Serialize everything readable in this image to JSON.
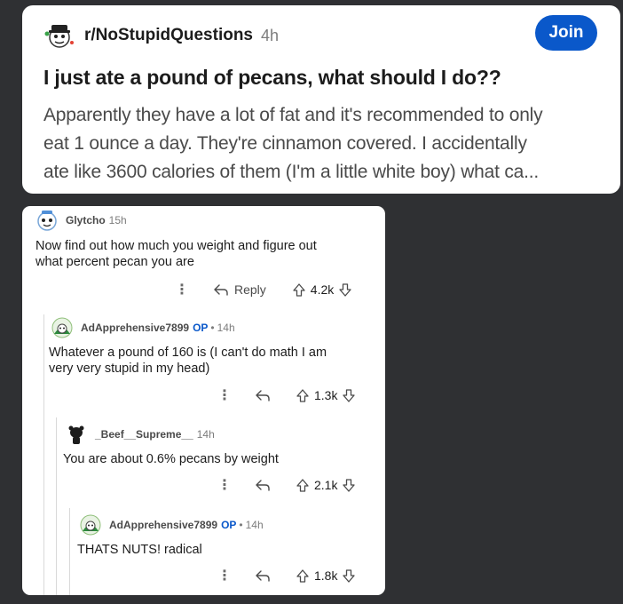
{
  "post": {
    "subreddit": "r/NoStupidQuestions",
    "age": "4h",
    "join_label": "Join",
    "title": "I just ate a pound of pecans, what should I do??",
    "body_lines": [
      "Apparently they have a lot of fat and it's recommended to only",
      "eat 1 ounce a day. They're cinnamon covered. I accidentally",
      "ate like 3600 calories of them (I'm a little white boy) what ca..."
    ]
  },
  "comments": [
    {
      "user": "Glytcho",
      "age": "15h",
      "text_lines": [
        "Now find out how much you weight and figure out",
        "what percent pecan you are"
      ],
      "reply_label": "Reply",
      "votes": "4.2k"
    },
    {
      "user": "AdApprehensive7899",
      "op": "OP",
      "dot": "•",
      "age": "14h",
      "text_lines": [
        "Whatever a pound of 160 is (I can't do math I am",
        "very very stupid in my head)"
      ],
      "votes": "1.3k"
    },
    {
      "user": "_Beef__Supreme__",
      "age": "14h",
      "text_lines": [
        "You are about 0.6% pecans by weight"
      ],
      "votes": "2.1k"
    },
    {
      "user": "AdApprehensive7899",
      "op": "OP",
      "dot": "•",
      "age": "14h",
      "text_lines": [
        "THATS NUTS! radical"
      ],
      "votes": "1.8k"
    }
  ],
  "icons": {
    "more": "⋮"
  },
  "colors": {
    "background": "#2f3033",
    "join_button": "#0a58ca",
    "op_badge": "#0a58ca"
  }
}
